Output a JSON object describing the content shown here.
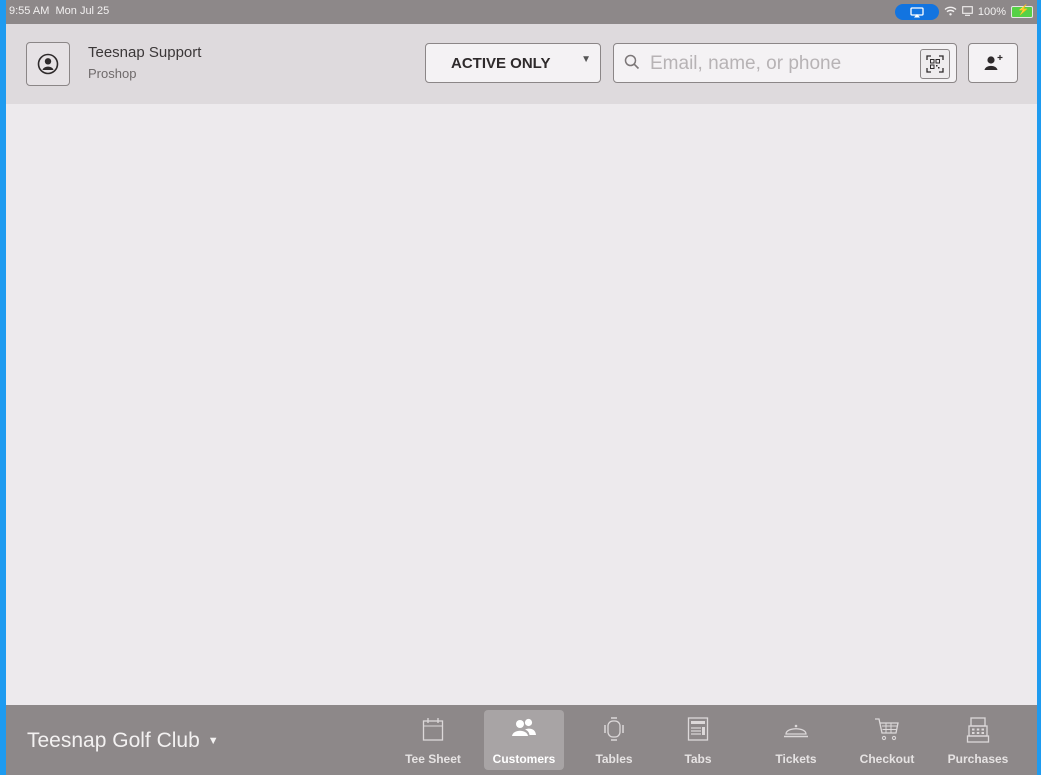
{
  "status_bar": {
    "time": "9:55 AM",
    "date": "Mon Jul 25",
    "battery": "100%"
  },
  "header": {
    "user_name": "Teesnap Support",
    "user_role": "Proshop",
    "filter_label": "ACTIVE ONLY",
    "search_placeholder": "Email, name, or phone",
    "search_value": ""
  },
  "footer": {
    "venue": "Teesnap Golf Club",
    "tabs": [
      {
        "label": "Tee Sheet",
        "icon": "calendar-icon",
        "active": false
      },
      {
        "label": "Customers",
        "icon": "customers-icon",
        "active": true
      },
      {
        "label": "Tables",
        "icon": "table-icon",
        "active": false
      },
      {
        "label": "Tabs",
        "icon": "receipt-icon",
        "active": false
      },
      {
        "label": "Tickets",
        "icon": "cloche-icon",
        "active": false
      },
      {
        "label": "Checkout",
        "icon": "cart-icon",
        "active": false
      },
      {
        "label": "Purchases",
        "icon": "register-icon",
        "active": false
      }
    ]
  },
  "colors": {
    "accent": "#1e9bf0",
    "bar": "#8d8889",
    "background": "#edeaed",
    "airplay": "#1274e0",
    "battery": "#56d146"
  }
}
